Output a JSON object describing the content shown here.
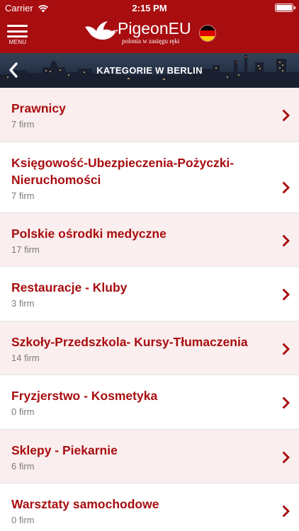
{
  "status_bar": {
    "carrier": "Carrier",
    "time": "2:15 PM"
  },
  "header": {
    "menu_label": "MENU",
    "app_title": "PigeonEU",
    "tagline": "polonia w zasięgu ręki",
    "flag": "germany-flag-icon",
    "background_color": "#a80d10"
  },
  "subheader": {
    "title": "KATEGORIE W BERLIN"
  },
  "categories": [
    {
      "title": "Prawnicy",
      "count": "7 firm"
    },
    {
      "title": "Księgowość-Ubezpieczenia-Pożyczki-Nieruchomości",
      "count": "7 firm"
    },
    {
      "title": "Polskie ośrodki medyczne",
      "count": "17 firm"
    },
    {
      "title": "Restauracje - Kluby",
      "count": "3 firm"
    },
    {
      "title": "Szkoły-Przedszkola- Kursy-Tłumaczenia",
      "count": "14 firm"
    },
    {
      "title": "Fryzjerstwo - Kosmetyka",
      "count": "0 firm"
    },
    {
      "title": "Sklepy - Piekarnie",
      "count": "6 firm"
    },
    {
      "title": "Warsztaty samochodowe",
      "count": "0 firm"
    }
  ],
  "colors": {
    "accent": "#a80d10",
    "row_tint": "#fbeeee",
    "count_text": "#7b7b7b"
  }
}
